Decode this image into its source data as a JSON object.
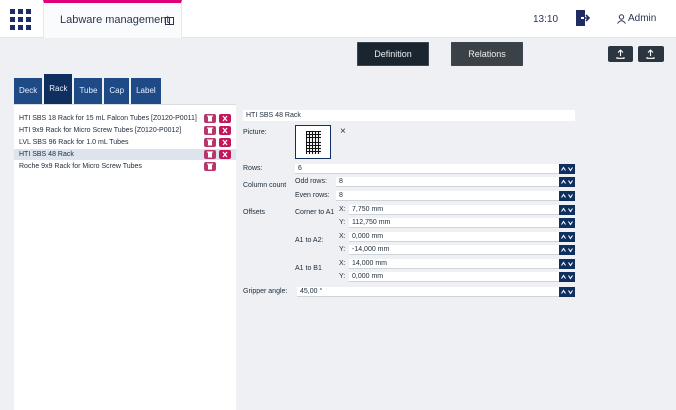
{
  "app": {
    "title": "Labware management",
    "time": "13:10",
    "user": "Admin"
  },
  "header_buttons": {
    "definition": "Definition",
    "relations": "Relations"
  },
  "tabs": [
    {
      "label": "Deck",
      "active": false
    },
    {
      "label": "Rack",
      "active": true
    },
    {
      "label": "Tube",
      "active": false
    },
    {
      "label": "Cap",
      "active": false
    },
    {
      "label": "Label",
      "active": false
    }
  ],
  "list": [
    {
      "label": "HTI SBS 18 Rack for 15 mL Falcon Tubes [Z0120-P0011]",
      "selected": false
    },
    {
      "label": "HTI 9x9 Rack for Micro Screw Tubes [Z0120-P0012]",
      "selected": false
    },
    {
      "label": "LVL SBS 96 Rack for 1.0 mL Tubes",
      "selected": false
    },
    {
      "label": "HTI SBS 48 Rack",
      "selected": true
    },
    {
      "label": "Roche 9x9 Rack for Micro Screw Tubes",
      "selected": false
    }
  ],
  "form": {
    "name": "HTI SBS 48 Rack",
    "picture_label": "Picture:",
    "rows_label": "Rows:",
    "rows_value": "6",
    "column_count_label": "Column count",
    "odd_rows_label": "Odd rows:",
    "odd_rows_value": "8",
    "even_rows_label": "Even rows:",
    "even_rows_value": "8",
    "offsets_label": "Offsets",
    "corner_label": "Corner to A1",
    "a1a2_label": "A1 to A2:",
    "a1b1_label": "A1 to B1",
    "x_label": "X:",
    "y_label": "Y:",
    "corner_x": "7,750 mm",
    "corner_y": "112,750 mm",
    "a1a2_x": "0,000 mm",
    "a1a2_y": "-14,000 mm",
    "a1b1_x": "14,000 mm",
    "a1b1_y": "0,000 mm",
    "gripper_label": "Gripper angle:",
    "gripper_value": "45,00 °"
  },
  "colors": {
    "accent": "#e0007a",
    "primary": "#0f2f5e",
    "tab": "#1e4b86",
    "delete": "#c2185b"
  }
}
